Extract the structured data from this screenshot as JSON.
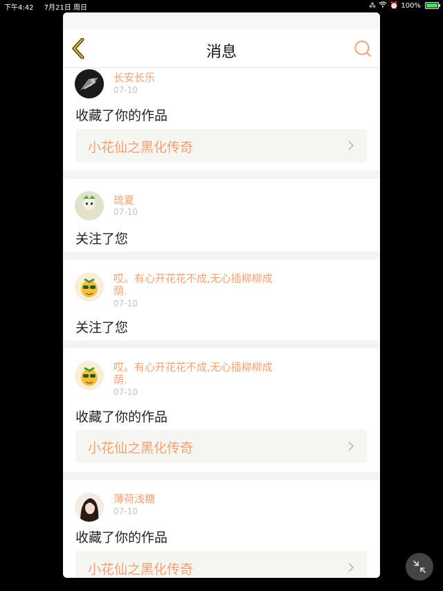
{
  "status_bar": {
    "time": "下午4:42",
    "date": "7月21日 周日",
    "battery": "100%"
  },
  "header": {
    "title": "消息",
    "back_icon": "chevron-left-icon",
    "search_icon": "search-icon"
  },
  "messages": [
    {
      "user": "长安长乐",
      "date": "07-10",
      "action": "收藏了你的作品",
      "work": "小花仙之黑化传奇"
    },
    {
      "user": "琉夏",
      "date": "07-10",
      "action": "关注了您"
    },
    {
      "user": "哎。有心开花花不成,无心插柳柳成荫.",
      "date": "07-10",
      "action": "关注了您"
    },
    {
      "user": "哎。有心开花花不成,无心插柳柳成荫.",
      "date": "07-10",
      "action": "收藏了你的作品",
      "work": "小花仙之黑化传奇"
    },
    {
      "user": "薄荷浅糖",
      "date": "07-10",
      "action": "收藏了你的作品",
      "work": "小花仙之黑化传奇"
    }
  ],
  "colors": {
    "accent": "#f0a070",
    "back_icon": "#e0b020"
  }
}
